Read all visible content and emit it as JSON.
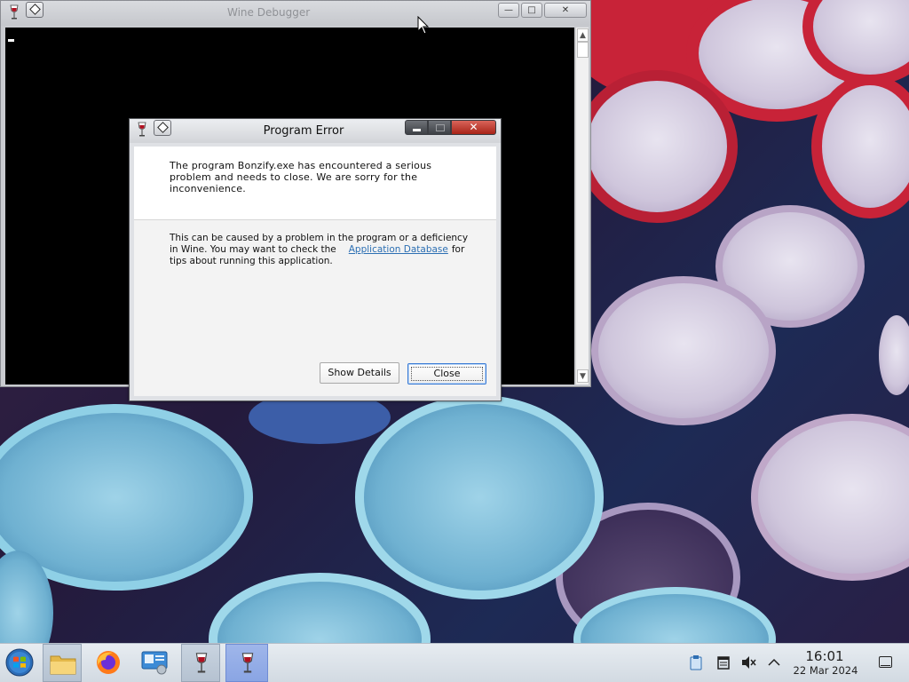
{
  "desktop": {
    "wallpaper": "colorful-cups-photo"
  },
  "console_window": {
    "title": "Wine Debugger",
    "title_icon": "wine-glass-icon",
    "sys_menu_icon": "diamond-menu-icon",
    "minimize_label": "—",
    "maximize_label": "□",
    "close_label": "✕",
    "scroll_up": "▲",
    "scroll_down": "▼"
  },
  "error_dialog": {
    "title": "Program Error",
    "message_main": "The program Bonzify.exe has encountered a serious problem and needs to close. We are sorry for the inconvenience.",
    "message_detail_part1": "This can be caused by a problem in the program or a deficiency in Wine. You may want to check the",
    "link_text": "Application Database",
    "message_detail_part2": "for tips about running this application.",
    "close_glyph": "✕",
    "buttons": {
      "show_details": "Show Details",
      "close": "Close"
    }
  },
  "taskbar": {
    "items": [
      {
        "name": "start-menu-button",
        "icon": "start-orb-icon"
      },
      {
        "name": "file-manager",
        "icon": "folder-icon"
      },
      {
        "name": "firefox",
        "icon": "firefox-icon"
      },
      {
        "name": "system-settings",
        "icon": "settings-screen-icon"
      },
      {
        "name": "wine-debugger-task",
        "icon": "wine-glass-icon"
      },
      {
        "name": "program-error-task",
        "icon": "wine-glass-icon"
      }
    ],
    "tray": {
      "items": [
        "clipboard-icon",
        "notes-icon",
        "muted-speaker-icon",
        "chevron-up-icon"
      ],
      "time": "16:01",
      "date": "22 Mar 2024"
    }
  },
  "colors": {
    "close_red": "#c0392b",
    "link_blue": "#2c6fb3",
    "focus_blue": "#3a7bd5",
    "active_task": "#8aa5e4"
  }
}
